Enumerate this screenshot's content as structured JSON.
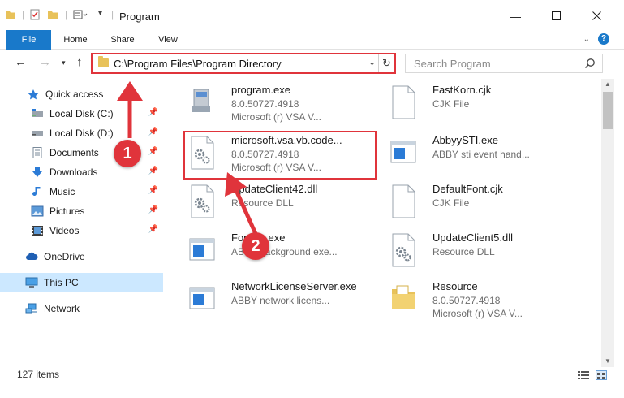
{
  "window": {
    "title": "Program"
  },
  "ribbon": {
    "tabs": [
      {
        "label": "File"
      },
      {
        "label": "Home"
      },
      {
        "label": "Share"
      },
      {
        "label": "View"
      }
    ]
  },
  "addressbar": {
    "path": "C:\\Program Files\\Program Directory"
  },
  "search": {
    "placeholder": "Search Program"
  },
  "sidebar": {
    "items": [
      {
        "label": "Quick access",
        "icon": "star-icon",
        "pinned": false
      },
      {
        "label": "Local Disk (C:)",
        "icon": "drive-icon",
        "pinned": true
      },
      {
        "label": "Local Disk (D:)",
        "icon": "drive-icon",
        "pinned": true
      },
      {
        "label": "Documents",
        "icon": "documents-icon",
        "pinned": true
      },
      {
        "label": "Downloads",
        "icon": "download-arrow-icon",
        "pinned": true
      },
      {
        "label": "Music",
        "icon": "music-note-icon",
        "pinned": true
      },
      {
        "label": "Pictures",
        "icon": "pictures-icon",
        "pinned": true
      },
      {
        "label": "Videos",
        "icon": "film-icon",
        "pinned": true
      },
      {
        "label": "OneDrive",
        "icon": "cloud-icon",
        "pinned": false
      },
      {
        "label": "This PC",
        "icon": "monitor-icon",
        "pinned": false,
        "selected": true
      },
      {
        "label": "Network",
        "icon": "network-icon",
        "pinned": false
      }
    ]
  },
  "files": [
    {
      "name": "program.exe",
      "line1": "8.0.50727.4918",
      "line2": "Microsoft (r) VSA V...",
      "icon": "exe-installer-icon"
    },
    {
      "name": "FastKorn.cjk",
      "line1": "CJK File",
      "line2": "",
      "icon": "blank-file-icon"
    },
    {
      "name": "microsoft.vsa.vb.code...",
      "line1": "8.0.50727.4918",
      "line2": "Microsoft (r) VSA V...",
      "icon": "dll-gear-file-icon"
    },
    {
      "name": "AbbyySTI.exe",
      "line1": "ABBY sti event hand...",
      "line2": "",
      "icon": "exe-window-icon"
    },
    {
      "name": "UpdateClient42.dll",
      "line1": "Resource DLL",
      "line2": "",
      "icon": "dll-gear-file-icon"
    },
    {
      "name": "DefaultFont.cjk",
      "line1": "CJK File",
      "line2": "",
      "icon": "blank-file-icon"
    },
    {
      "name": "FontBg.exe",
      "line1": "ABBY background exe...",
      "line2": "",
      "icon": "exe-window-icon"
    },
    {
      "name": "UpdateClient5.dll",
      "line1": "Resource DLL",
      "line2": "",
      "icon": "dll-gear-file-icon"
    },
    {
      "name": "NetworkLicenseServer.exe",
      "line1": "ABBY network licens...",
      "line2": "",
      "icon": "exe-window-icon"
    },
    {
      "name": "Resource",
      "line1": "8.0.50727.4918",
      "line2": "Microsoft (r) VSA V...",
      "icon": "folder-icon"
    }
  ],
  "status": {
    "item_count": "127 items"
  },
  "callouts": [
    {
      "label": "1"
    },
    {
      "label": "2"
    }
  ],
  "colors": {
    "accent": "#1979ca",
    "highlight_red": "#e0343b",
    "selected_bg": "#cce8ff"
  }
}
